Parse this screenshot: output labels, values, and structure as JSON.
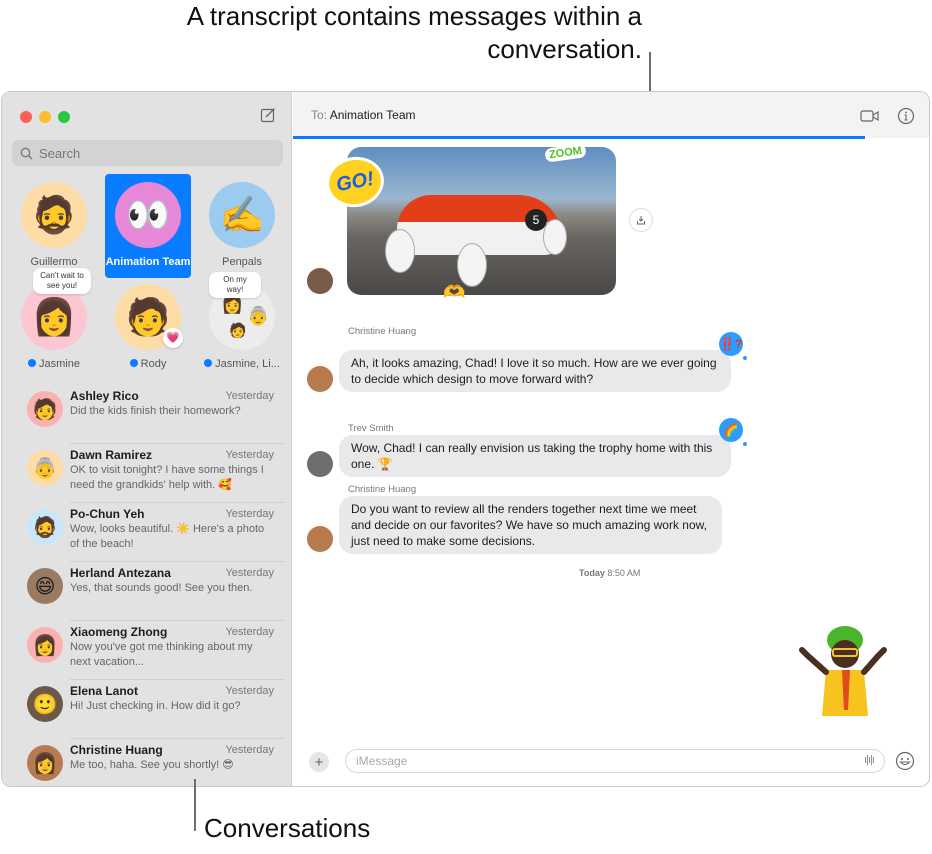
{
  "callouts": {
    "transcript": "A transcript contains messages within a conversation.",
    "conversations": "Conversations"
  },
  "sidebar": {
    "search_placeholder": "Search",
    "pinned": [
      {
        "label": "Guillermo",
        "icon": "memoji-bearded-man",
        "bg": "#fedca6",
        "active": false,
        "unread": false
      },
      {
        "label": "Animation Team",
        "icon": "eyes-emoji",
        "bg": "#e787d8",
        "active": true,
        "unread": false
      },
      {
        "label": "Penpals",
        "icon": "writing-hand-emoji",
        "bg": "#9ccbf0",
        "active": false,
        "unread": false
      },
      {
        "label": "Jasmine",
        "icon": "memoji-woman-glasses",
        "bg": "#fdc6d3",
        "active": false,
        "unread": true,
        "bubble": "Can't wait to see you!"
      },
      {
        "label": "Rody",
        "icon": "memoji-green-beanie",
        "bg": "#fedca6",
        "active": false,
        "unread": true,
        "tapback": "heart"
      },
      {
        "label": "Jasmine, Li...",
        "icon": "group-avatars",
        "bg": "#ececec",
        "active": false,
        "unread": true,
        "bubble": "On my way!"
      }
    ],
    "conversations": [
      {
        "name": "Ashley Rico",
        "time": "Yesterday",
        "preview": "Did the kids finish their homework?",
        "bg": "#fbb1b1",
        "icon": "🧑"
      },
      {
        "name": "Dawn Ramirez",
        "time": "Yesterday",
        "preview": "OK to visit tonight? I have some things I need the grandkids' help with. 🥰",
        "bg": "#fedca6",
        "icon": "👵"
      },
      {
        "name": "Po-Chun Yeh",
        "time": "Yesterday",
        "preview": "Wow, looks beautiful. ☀️ Here's a photo of the beach!",
        "bg": "#c8e7fb",
        "icon": "🧔"
      },
      {
        "name": "Herland Antezana",
        "time": "Yesterday",
        "preview": "Yes, that sounds good! See you then.",
        "bg": "#9a7b62",
        "icon": "😄"
      },
      {
        "name": "Xiaomeng Zhong",
        "time": "Yesterday",
        "preview": "Now you've got me thinking about my next vacation...",
        "bg": "#fbb1b1",
        "icon": "👩"
      },
      {
        "name": "Elena Lanot",
        "time": "Yesterday",
        "preview": "Hi! Just checking in. How did it go?",
        "bg": "#6b5a4a",
        "icon": "🙂"
      },
      {
        "name": "Christine Huang",
        "time": "Yesterday",
        "preview": "Me too, haha. See you shortly! 😎",
        "bg": "#b87b4f",
        "icon": "👩"
      }
    ]
  },
  "transcript": {
    "to_label": "To:",
    "recipient": "Animation Team",
    "send_progress": 0.9,
    "stickers": {
      "go": "GO!",
      "zoom": "ZOOM",
      "number": "5"
    },
    "messages": [
      {
        "sender": "Christine Huang",
        "text": "Ah, it looks amazing, Chad! I love it so much. How are we ever going to decide which design to move forward with?",
        "tapback": "‼️?"
      },
      {
        "sender": "Trev Smith",
        "text": "Wow, Chad! I can really envision us taking the trophy home with this one. 🏆",
        "tapback": "🌈"
      },
      {
        "sender": "Christine Huang",
        "text": "Do you want to review all the renders together next time we meet and decide on our favorites? We have so much amazing work now, just need to make some decisions.",
        "tapback": null
      }
    ],
    "timestamp_day": "Today",
    "timestamp_time": "8:50 AM",
    "composer_placeholder": "iMessage"
  }
}
